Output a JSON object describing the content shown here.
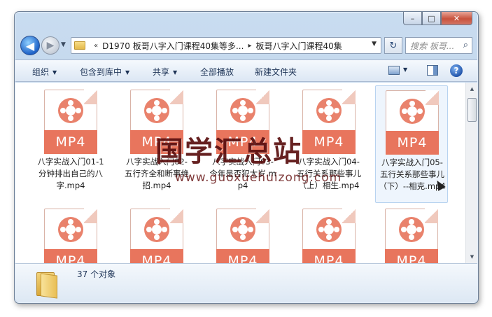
{
  "window": {
    "controls": {
      "minimize": "–",
      "maximize": "□",
      "close": "✕"
    }
  },
  "nav": {
    "back_glyph": "◀",
    "forward_glyph": "▶",
    "history_glyph": "▼",
    "breadcrumb": [
      "D1970 板哥八字入门课程40集等多...",
      "板哥八字入门课程40集"
    ],
    "overflow": "«",
    "separator": "▸",
    "refresh_glyph": "↻",
    "search_placeholder": "搜索 板哥...",
    "search_glyph": "⌕"
  },
  "toolbar": {
    "organize": "组织",
    "include_in_library": "包含到库中",
    "share": "共享",
    "play_all": "全部播放",
    "new_folder": "新建文件夹",
    "dropdown_glyph": "▼",
    "help_glyph": "?"
  },
  "files": {
    "row1": [
      {
        "badge": "MP4",
        "name": "八字实战入门01-1分钟排出自己的八字.mp4"
      },
      {
        "badge": "MP4",
        "name": "八字实战入门02-五行齐全和断事绝招.mp4"
      },
      {
        "badge": "MP4",
        "name": "八字实战入门03-今年是否犯太岁.mp4"
      },
      {
        "badge": "MP4",
        "name": "八字实战入门04-五行关系那些事儿（上）相生.mp4"
      },
      {
        "badge": "MP4",
        "name": "八字实战入门05-五行关系那些事儿（下）--相克.mp4"
      }
    ],
    "row2": [
      {
        "badge": "MP4"
      },
      {
        "badge": "MP4"
      },
      {
        "badge": "MP4"
      },
      {
        "badge": "MP4"
      },
      {
        "badge": "MP4"
      }
    ]
  },
  "scrollbar": {
    "up": "▲",
    "down": "▼"
  },
  "status": {
    "count": "37 个对象"
  },
  "watermark": {
    "title": "国学汇总站",
    "url": "www.guoxuehuizong.com"
  }
}
